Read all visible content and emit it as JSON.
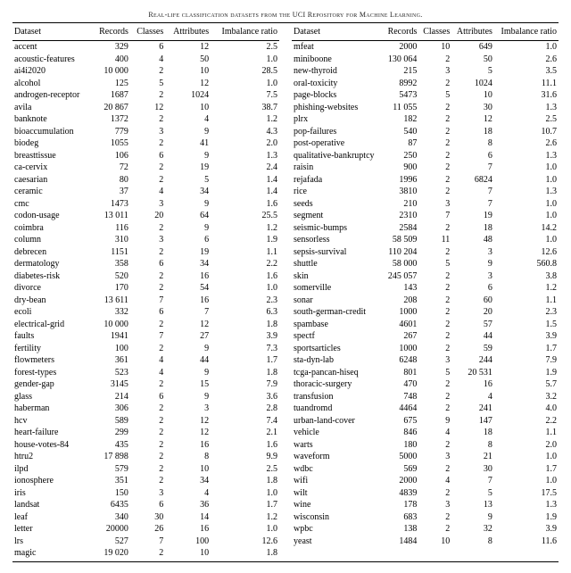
{
  "caption": "Real-life classification datasets from the UCI Repository for Machine Learning.",
  "headers": {
    "dataset": "Dataset",
    "records": "Records",
    "classes": "Classes",
    "attributes": "Attributes",
    "imbalance": "Imbalance ratio"
  },
  "left": [
    {
      "name": "accent",
      "records": "329",
      "classes": "6",
      "attributes": "12",
      "imb": "2.5"
    },
    {
      "name": "acoustic-features",
      "records": "400",
      "classes": "4",
      "attributes": "50",
      "imb": "1.0"
    },
    {
      "name": "ai4i2020",
      "records": "10 000",
      "classes": "2",
      "attributes": "10",
      "imb": "28.5"
    },
    {
      "name": "alcohol",
      "records": "125",
      "classes": "5",
      "attributes": "12",
      "imb": "1.0"
    },
    {
      "name": "androgen-receptor",
      "records": "1687",
      "classes": "2",
      "attributes": "1024",
      "imb": "7.5"
    },
    {
      "name": "avila",
      "records": "20 867",
      "classes": "12",
      "attributes": "10",
      "imb": "38.7"
    },
    {
      "name": "banknote",
      "records": "1372",
      "classes": "2",
      "attributes": "4",
      "imb": "1.2"
    },
    {
      "name": "bioaccumulation",
      "records": "779",
      "classes": "3",
      "attributes": "9",
      "imb": "4.3"
    },
    {
      "name": "biodeg",
      "records": "1055",
      "classes": "2",
      "attributes": "41",
      "imb": "2.0"
    },
    {
      "name": "breasttissue",
      "records": "106",
      "classes": "6",
      "attributes": "9",
      "imb": "1.3"
    },
    {
      "name": "ca-cervix",
      "records": "72",
      "classes": "2",
      "attributes": "19",
      "imb": "2.4"
    },
    {
      "name": "caesarian",
      "records": "80",
      "classes": "2",
      "attributes": "5",
      "imb": "1.4"
    },
    {
      "name": "ceramic",
      "records": "37",
      "classes": "4",
      "attributes": "34",
      "imb": "1.4"
    },
    {
      "name": "cmc",
      "records": "1473",
      "classes": "3",
      "attributes": "9",
      "imb": "1.6"
    },
    {
      "name": "codon-usage",
      "records": "13 011",
      "classes": "20",
      "attributes": "64",
      "imb": "25.5"
    },
    {
      "name": "coimbra",
      "records": "116",
      "classes": "2",
      "attributes": "9",
      "imb": "1.2"
    },
    {
      "name": "column",
      "records": "310",
      "classes": "3",
      "attributes": "6",
      "imb": "1.9"
    },
    {
      "name": "debrecen",
      "records": "1151",
      "classes": "2",
      "attributes": "19",
      "imb": "1.1"
    },
    {
      "name": "dermatology",
      "records": "358",
      "classes": "6",
      "attributes": "34",
      "imb": "2.2"
    },
    {
      "name": "diabetes-risk",
      "records": "520",
      "classes": "2",
      "attributes": "16",
      "imb": "1.6"
    },
    {
      "name": "divorce",
      "records": "170",
      "classes": "2",
      "attributes": "54",
      "imb": "1.0"
    },
    {
      "name": "dry-bean",
      "records": "13 611",
      "classes": "7",
      "attributes": "16",
      "imb": "2.3"
    },
    {
      "name": "ecoli",
      "records": "332",
      "classes": "6",
      "attributes": "7",
      "imb": "6.3"
    },
    {
      "name": "electrical-grid",
      "records": "10 000",
      "classes": "2",
      "attributes": "12",
      "imb": "1.8"
    },
    {
      "name": "faults",
      "records": "1941",
      "classes": "7",
      "attributes": "27",
      "imb": "3.9"
    },
    {
      "name": "fertility",
      "records": "100",
      "classes": "2",
      "attributes": "9",
      "imb": "7.3"
    },
    {
      "name": "flowmeters",
      "records": "361",
      "classes": "4",
      "attributes": "44",
      "imb": "1.7"
    },
    {
      "name": "forest-types",
      "records": "523",
      "classes": "4",
      "attributes": "9",
      "imb": "1.8"
    },
    {
      "name": "gender-gap",
      "records": "3145",
      "classes": "2",
      "attributes": "15",
      "imb": "7.9"
    },
    {
      "name": "glass",
      "records": "214",
      "classes": "6",
      "attributes": "9",
      "imb": "3.6"
    },
    {
      "name": "haberman",
      "records": "306",
      "classes": "2",
      "attributes": "3",
      "imb": "2.8"
    },
    {
      "name": "hcv",
      "records": "589",
      "classes": "2",
      "attributes": "12",
      "imb": "7.4"
    },
    {
      "name": "heart-failure",
      "records": "299",
      "classes": "2",
      "attributes": "12",
      "imb": "2.1"
    },
    {
      "name": "house-votes-84",
      "records": "435",
      "classes": "2",
      "attributes": "16",
      "imb": "1.6"
    },
    {
      "name": "htru2",
      "records": "17 898",
      "classes": "2",
      "attributes": "8",
      "imb": "9.9"
    },
    {
      "name": "ilpd",
      "records": "579",
      "classes": "2",
      "attributes": "10",
      "imb": "2.5"
    },
    {
      "name": "ionosphere",
      "records": "351",
      "classes": "2",
      "attributes": "34",
      "imb": "1.8"
    },
    {
      "name": "iris",
      "records": "150",
      "classes": "3",
      "attributes": "4",
      "imb": "1.0"
    },
    {
      "name": "landsat",
      "records": "6435",
      "classes": "6",
      "attributes": "36",
      "imb": "1.7"
    },
    {
      "name": "leaf",
      "records": "340",
      "classes": "30",
      "attributes": "14",
      "imb": "1.2"
    },
    {
      "name": "letter",
      "records": "20000",
      "classes": "26",
      "attributes": "16",
      "imb": "1.0"
    },
    {
      "name": "lrs",
      "records": "527",
      "classes": "7",
      "attributes": "100",
      "imb": "12.6"
    },
    {
      "name": "magic",
      "records": "19 020",
      "classes": "2",
      "attributes": "10",
      "imb": "1.8"
    }
  ],
  "right": [
    {
      "name": "mfeat",
      "records": "2000",
      "classes": "10",
      "attributes": "649",
      "imb": "1.0"
    },
    {
      "name": "miniboone",
      "records": "130 064",
      "classes": "2",
      "attributes": "50",
      "imb": "2.6"
    },
    {
      "name": "new-thyroid",
      "records": "215",
      "classes": "3",
      "attributes": "5",
      "imb": "3.5"
    },
    {
      "name": "oral-toxicity",
      "records": "8992",
      "classes": "2",
      "attributes": "1024",
      "imb": "11.1"
    },
    {
      "name": "page-blocks",
      "records": "5473",
      "classes": "5",
      "attributes": "10",
      "imb": "31.6"
    },
    {
      "name": "phishing-websites",
      "records": "11 055",
      "classes": "2",
      "attributes": "30",
      "imb": "1.3"
    },
    {
      "name": "plrx",
      "records": "182",
      "classes": "2",
      "attributes": "12",
      "imb": "2.5"
    },
    {
      "name": "pop-failures",
      "records": "540",
      "classes": "2",
      "attributes": "18",
      "imb": "10.7"
    },
    {
      "name": "post-operative",
      "records": "87",
      "classes": "2",
      "attributes": "8",
      "imb": "2.6"
    },
    {
      "name": "qualitative-bankruptcy",
      "records": "250",
      "classes": "2",
      "attributes": "6",
      "imb": "1.3"
    },
    {
      "name": "raisin",
      "records": "900",
      "classes": "2",
      "attributes": "7",
      "imb": "1.0"
    },
    {
      "name": "rejafada",
      "records": "1996",
      "classes": "2",
      "attributes": "6824",
      "imb": "1.0"
    },
    {
      "name": "rice",
      "records": "3810",
      "classes": "2",
      "attributes": "7",
      "imb": "1.3"
    },
    {
      "name": "seeds",
      "records": "210",
      "classes": "3",
      "attributes": "7",
      "imb": "1.0"
    },
    {
      "name": "segment",
      "records": "2310",
      "classes": "7",
      "attributes": "19",
      "imb": "1.0"
    },
    {
      "name": "seismic-bumps",
      "records": "2584",
      "classes": "2",
      "attributes": "18",
      "imb": "14.2"
    },
    {
      "name": "sensorless",
      "records": "58 509",
      "classes": "11",
      "attributes": "48",
      "imb": "1.0"
    },
    {
      "name": "sepsis-survival",
      "records": "110 204",
      "classes": "2",
      "attributes": "3",
      "imb": "12.6"
    },
    {
      "name": "shuttle",
      "records": "58 000",
      "classes": "5",
      "attributes": "9",
      "imb": "560.8"
    },
    {
      "name": "skin",
      "records": "245 057",
      "classes": "2",
      "attributes": "3",
      "imb": "3.8"
    },
    {
      "name": "somerville",
      "records": "143",
      "classes": "2",
      "attributes": "6",
      "imb": "1.2"
    },
    {
      "name": "sonar",
      "records": "208",
      "classes": "2",
      "attributes": "60",
      "imb": "1.1"
    },
    {
      "name": "south-german-credit",
      "records": "1000",
      "classes": "2",
      "attributes": "20",
      "imb": "2.3"
    },
    {
      "name": "spambase",
      "records": "4601",
      "classes": "2",
      "attributes": "57",
      "imb": "1.5"
    },
    {
      "name": "spectf",
      "records": "267",
      "classes": "2",
      "attributes": "44",
      "imb": "3.9"
    },
    {
      "name": "sportsarticles",
      "records": "1000",
      "classes": "2",
      "attributes": "59",
      "imb": "1.7"
    },
    {
      "name": "sta-dyn-lab",
      "records": "6248",
      "classes": "3",
      "attributes": "244",
      "imb": "7.9"
    },
    {
      "name": "tcga-pancan-hiseq",
      "records": "801",
      "classes": "5",
      "attributes": "20 531",
      "imb": "1.9"
    },
    {
      "name": "thoracic-surgery",
      "records": "470",
      "classes": "2",
      "attributes": "16",
      "imb": "5.7"
    },
    {
      "name": "transfusion",
      "records": "748",
      "classes": "2",
      "attributes": "4",
      "imb": "3.2"
    },
    {
      "name": "tuandromd",
      "records": "4464",
      "classes": "2",
      "attributes": "241",
      "imb": "4.0"
    },
    {
      "name": "urban-land-cover",
      "records": "675",
      "classes": "9",
      "attributes": "147",
      "imb": "2.2"
    },
    {
      "name": "vehicle",
      "records": "846",
      "classes": "4",
      "attributes": "18",
      "imb": "1.1"
    },
    {
      "name": "warts",
      "records": "180",
      "classes": "2",
      "attributes": "8",
      "imb": "2.0"
    },
    {
      "name": "waveform",
      "records": "5000",
      "classes": "3",
      "attributes": "21",
      "imb": "1.0"
    },
    {
      "name": "wdbc",
      "records": "569",
      "classes": "2",
      "attributes": "30",
      "imb": "1.7"
    },
    {
      "name": "wifi",
      "records": "2000",
      "classes": "4",
      "attributes": "7",
      "imb": "1.0"
    },
    {
      "name": "wilt",
      "records": "4839",
      "classes": "2",
      "attributes": "5",
      "imb": "17.5"
    },
    {
      "name": "wine",
      "records": "178",
      "classes": "3",
      "attributes": "13",
      "imb": "1.3"
    },
    {
      "name": "wisconsin",
      "records": "683",
      "classes": "2",
      "attributes": "9",
      "imb": "1.9"
    },
    {
      "name": "wpbc",
      "records": "138",
      "classes": "2",
      "attributes": "32",
      "imb": "3.9"
    },
    {
      "name": "yeast",
      "records": "1484",
      "classes": "10",
      "attributes": "8",
      "imb": "11.6"
    }
  ]
}
